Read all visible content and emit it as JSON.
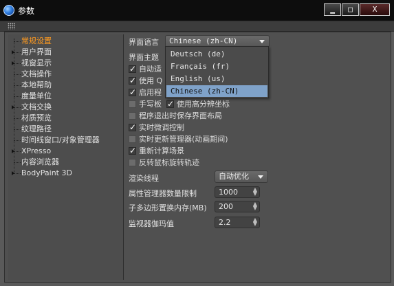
{
  "window": {
    "title": "参数",
    "buttons": {
      "minimize": "▁",
      "maximize": "□",
      "close": "X"
    }
  },
  "sidebar": {
    "items": [
      {
        "label": "常规设置",
        "active": true,
        "expandable": false
      },
      {
        "label": "用户界面",
        "active": false,
        "expandable": true
      },
      {
        "label": "视窗显示",
        "active": false,
        "expandable": true
      },
      {
        "label": "文档操作",
        "active": false,
        "expandable": false
      },
      {
        "label": "本地帮助",
        "active": false,
        "expandable": false
      },
      {
        "label": "度量单位",
        "active": false,
        "expandable": false
      },
      {
        "label": "文档交换",
        "active": false,
        "expandable": true
      },
      {
        "label": "材质预览",
        "active": false,
        "expandable": false
      },
      {
        "label": "纹理路径",
        "active": false,
        "expandable": false
      },
      {
        "label": "时间线窗口/对象管理器",
        "active": false,
        "expandable": false
      },
      {
        "label": "XPresso",
        "active": false,
        "expandable": true
      },
      {
        "label": "内容浏览器",
        "active": false,
        "expandable": false
      },
      {
        "label": "BodyPaint 3D",
        "active": false,
        "expandable": true
      }
    ]
  },
  "general": {
    "language_label": "界面语言",
    "language_value": "Chinese (zh-CN)",
    "theme_label": "界面主题",
    "language_options": [
      {
        "label": "Deutsch (de)",
        "selected": false
      },
      {
        "label": "Français (fr)",
        "selected": false
      },
      {
        "label": "English (us)",
        "selected": false
      },
      {
        "label": "Chinese (zh-CN)",
        "selected": true
      }
    ],
    "checkboxes": [
      {
        "label": "自动适",
        "checked": true
      },
      {
        "label": "使用 Q",
        "checked": true
      },
      {
        "label": "启用程",
        "checked": true
      },
      {
        "label": "手写板",
        "checked": false
      },
      {
        "label": "程序退出时保存界面布局",
        "checked": false
      },
      {
        "label": "实时微调控制",
        "checked": true
      },
      {
        "label": "实时更新管理器(动画期间)",
        "checked": false
      },
      {
        "label": "重新计算场景",
        "checked": true
      },
      {
        "label": "反转鼠标旋转轨迹",
        "checked": false
      }
    ],
    "hires_coords": {
      "label": "使用高分辨坐标",
      "checked": true
    },
    "render_thread_label": "渲染线程",
    "render_thread_value": "自动优化",
    "attr_limit_label": "属性管理器数量限制",
    "attr_limit_value": "1000",
    "poly_memory_label": "子多边形置换内存(MB)",
    "poly_memory_value": "200",
    "gamma_label": "监视器伽玛值",
    "gamma_value": "2.2"
  }
}
